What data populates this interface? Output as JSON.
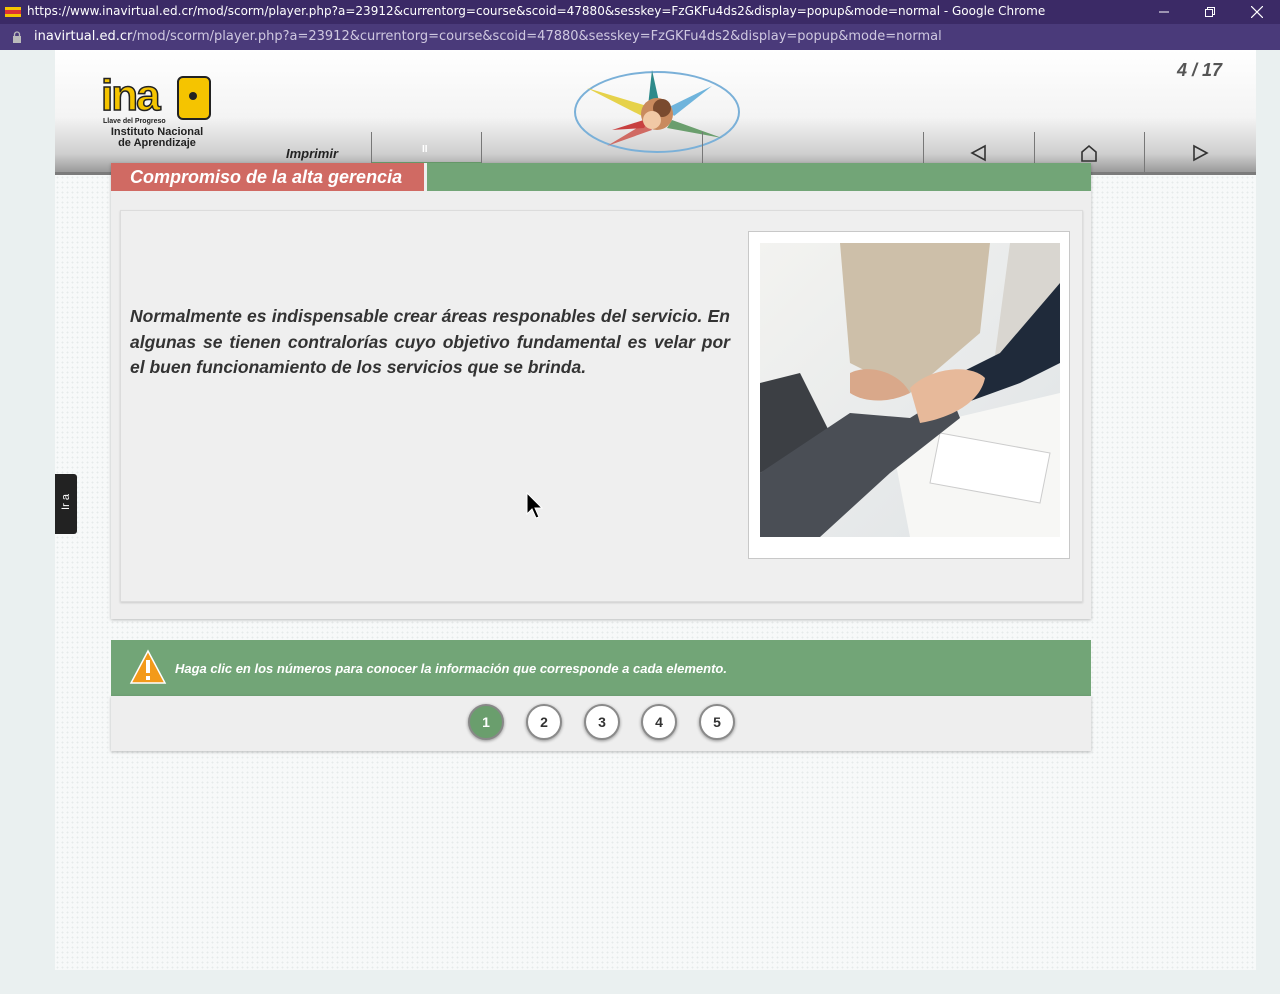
{
  "browser": {
    "window_title": "https://www.inavirtual.ed.cr/mod/scorm/player.php?a=23912&currentorg=course&scoid=47880&sesskey=FzGKFu4ds2&display=popup&mode=normal - Google Chrome",
    "url_host": "inavirtual.ed.cr",
    "url_path": "/mod/scorm/player.php?a=23912&currentorg=course&scoid=47880&sesskey=FzGKFu4ds2&display=popup&mode=normal",
    "controls": [
      "minimize",
      "restore",
      "close"
    ]
  },
  "header": {
    "logo": {
      "wordmark": "ina",
      "slogan": "Llave del Progreso",
      "name_line1": "Instituto Nacional",
      "name_line2": "de Aprendizaje"
    },
    "page_counter": "4 / 17",
    "print_label": "Imprimir",
    "pause_symbol": "II",
    "nav_icons": [
      "prev-icon",
      "home-icon",
      "next-icon"
    ]
  },
  "slide": {
    "title": "Compromiso de la alta gerencia",
    "body": "Normalmente es indispensable crear áreas responables del servicio. En algunas se tienen contralorías cuyo objetivo fundamental es velar por el buen funcionamiento de los servicios que se brinda.",
    "image_alt": "handshake",
    "colors": {
      "title_bg": "#d06a63",
      "accent_green": "#72a577"
    }
  },
  "instructions": {
    "text": "Haga clic en los números para conocer la información que corresponde a cada elemento.",
    "icon": "warning-icon"
  },
  "pager": {
    "numbers": [
      "1",
      "2",
      "3",
      "4",
      "5"
    ],
    "active": "1"
  },
  "side_tab": {
    "label": "Ir a"
  }
}
